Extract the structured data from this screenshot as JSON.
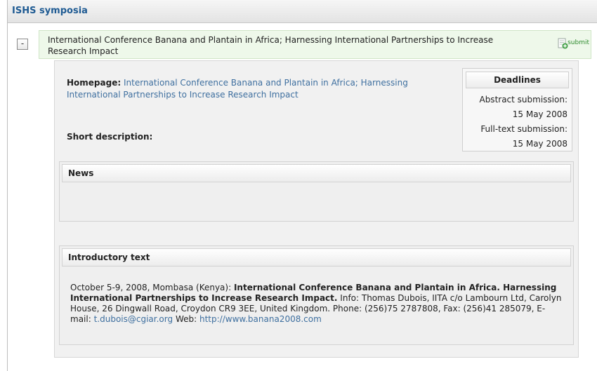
{
  "header": {
    "title": "ISHS symposia"
  },
  "conference": {
    "collapse_symbol": "-",
    "title": "International Conference Banana and Plantain in Africa; Harnessing International Partnerships to Increase Research Impact",
    "submit_label": "submit",
    "submit_icon": "document-add-icon"
  },
  "details": {
    "homepage_label": "Homepage:",
    "homepage_link": "International Conference Banana and Plantain in Africa; Harnessing International Partnerships to Increase Research Impact",
    "short_description_label": "Short description:"
  },
  "deadlines": {
    "title": "Deadlines",
    "abstract_label": "Abstract submission:",
    "abstract_date": "15 May 2008",
    "fulltext_label": "Full-text submission:",
    "fulltext_date": "15 May 2008"
  },
  "news": {
    "title": "News"
  },
  "intro": {
    "title": "Introductory text",
    "date_place": "October 5-9, 2008, Mombasa (Kenya):",
    "conf_name": "International Conference Banana and Plantain in Africa. Harnessing International Partnerships to Increase Research Impact.",
    "info": "Info: Thomas Dubois, IITA c/o Lambourn Ltd, Carolyn House, 26 Dingwall Road, Croydon CR9 3EE, United Kingdom. Phone: (256)75 2787808, Fax: (256)41 285079, E-mail:",
    "email": "t.dubois@cgiar.org",
    "web_label": "Web:",
    "web_url": "http://www.banana2008.com"
  }
}
